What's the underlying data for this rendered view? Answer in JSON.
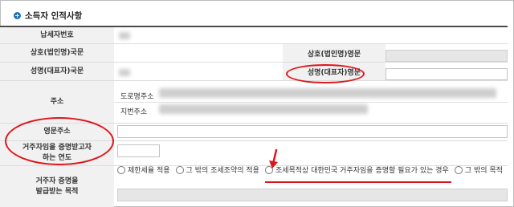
{
  "section": {
    "title": "소득자 인적사항"
  },
  "labels": {
    "tax_id": "납세자번호",
    "company_kr": "상호(법인명)국문",
    "company_en": "상호(법인명)영문",
    "name_kr": "성명(대표자)국문",
    "name_en": "성명(대표자)영문",
    "address": "주소",
    "road_address": "도로명주소",
    "lot_address": "지번주소",
    "address_en": "영문주소",
    "residency_year_line1": "거주자임을 증명받고자",
    "residency_year_line2": "하는 연도",
    "certificate_purpose_line1": "거주자 증명을",
    "certificate_purpose_line2": "발급받는 목적"
  },
  "radio_options": [
    "제한세율 적용",
    "그 밖의 조세조약의 적용",
    "조세목적상 대한민국 거주자임을 증명할 필요가 있는 경우",
    "그 밖의 목적"
  ],
  "annotation": {
    "color": "#e0141b"
  }
}
